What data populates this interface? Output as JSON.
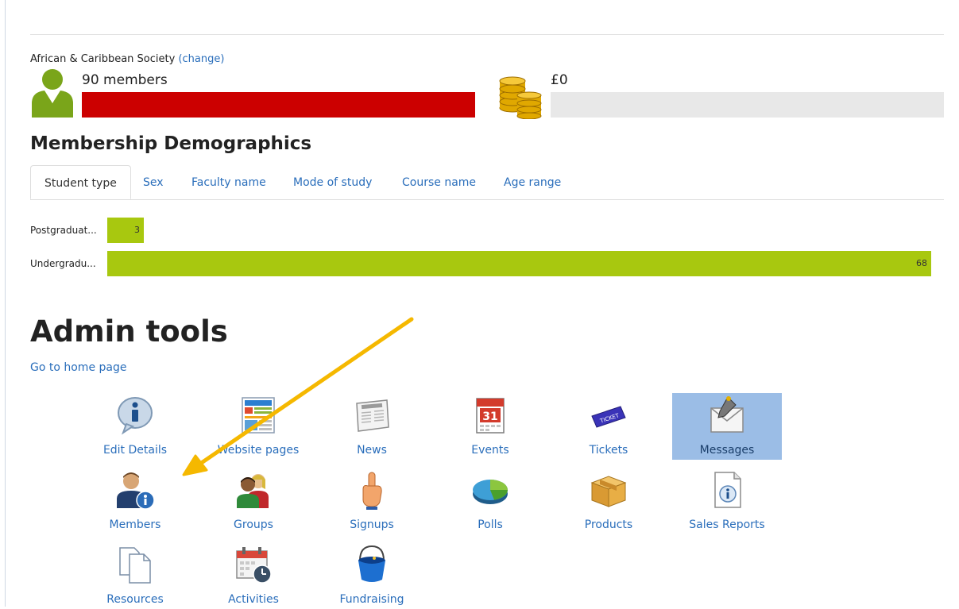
{
  "organisation": {
    "name": "African & Caribbean Society",
    "change_link": "(change)"
  },
  "stats": {
    "members_count": "90",
    "members_word": "members",
    "members_bar_color": "#cc0000",
    "money": "£0",
    "money_bar_color": "#e8e8e8"
  },
  "demographics": {
    "title": "Membership Demographics",
    "tabs": [
      {
        "label": "Student type",
        "active": true
      },
      {
        "label": "Sex"
      },
      {
        "label": "Faculty name"
      },
      {
        "label": "Mode of study"
      },
      {
        "label": "Course name"
      },
      {
        "label": "Age range"
      }
    ],
    "bar_color": "#a8c80f"
  },
  "chart_data": {
    "type": "bar",
    "orientation": "horizontal",
    "categories": [
      "Postgraduat...",
      "Undergradu..."
    ],
    "values": [
      3,
      68
    ]
  },
  "admin": {
    "title": "Admin tools",
    "home_link": "Go to home page",
    "tools": [
      {
        "label": "Edit Details",
        "icon": "info-bubble-icon"
      },
      {
        "label": "Website pages",
        "icon": "website-pages-icon"
      },
      {
        "label": "News",
        "icon": "newspaper-icon"
      },
      {
        "label": "Events",
        "icon": "calendar-icon"
      },
      {
        "label": "Tickets",
        "icon": "ticket-icon"
      },
      {
        "label": "Messages",
        "icon": "envelope-icon",
        "highlighted": true,
        "highlight_color": "#9bbde6"
      },
      {
        "label": "Members",
        "icon": "user-info-icon"
      },
      {
        "label": "Groups",
        "icon": "group-icon"
      },
      {
        "label": "Signups",
        "icon": "raised-hand-icon"
      },
      {
        "label": "Polls",
        "icon": "pie-chart-icon"
      },
      {
        "label": "Products",
        "icon": "box-icon"
      },
      {
        "label": "Sales Reports",
        "icon": "report-info-icon"
      },
      {
        "label": "Resources",
        "icon": "documents-icon"
      },
      {
        "label": "Activities",
        "icon": "calendar-clock-icon"
      },
      {
        "label": "Fundraising",
        "icon": "bucket-icon"
      }
    ]
  },
  "annotation": {
    "arrow_color": "#f5b800"
  },
  "colors": {
    "link": "#2a6ebb",
    "text": "#222222"
  }
}
